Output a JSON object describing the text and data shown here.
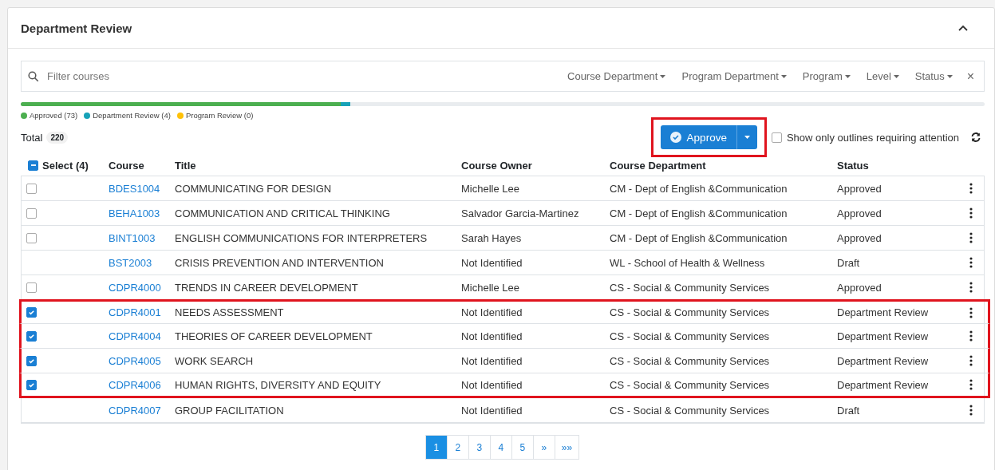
{
  "panel": {
    "title": "Department Review",
    "expanded": true
  },
  "filter": {
    "placeholder": "Filter courses",
    "dropdowns": [
      "Course Department",
      "Program Department",
      "Program",
      "Level",
      "Status"
    ],
    "clear": "×"
  },
  "progress": [
    {
      "label": "Approved (73)",
      "color": "#4caf50",
      "level": 0.332
    },
    {
      "label": "Department Review (4)",
      "color": "#17a2b8"
    },
    {
      "label": "Program Review (0)",
      "color": "#ffc107"
    }
  ],
  "total": {
    "label": "Total",
    "count": "220"
  },
  "approve": {
    "label": "Approve",
    "highlighted": true
  },
  "attention": {
    "label": "Show only outlines requiring attention",
    "checked": false
  },
  "table": {
    "select_all": {
      "checked": true,
      "indeterminate": true
    },
    "columns": [
      "Select (4)",
      "Course",
      "Title",
      "Course Owner",
      "Course Department",
      "Status"
    ],
    "rows": [
      {
        "checked": false,
        "highlighted": false,
        "course": "BDES1004",
        "title": "COMMUNICATING FOR DESIGN",
        "owner": "Michelle Lee",
        "department": "CM - Dept of English &Communication",
        "status": "Approved"
      },
      {
        "checked": false,
        "highlighted": false,
        "course": "BEHA1003",
        "title": "COMMUNICATION AND CRITICAL THINKING",
        "owner": "Salvador Garcia-Martinez",
        "department": "CM - Dept of English &Communication",
        "status": "Approved"
      },
      {
        "checked": false,
        "highlighted": false,
        "course": "BINT1003",
        "title": "ENGLISH COMMUNICATIONS FOR INTERPRETERS",
        "owner": "Sarah Hayes",
        "department": "CM - Dept of English &Communication",
        "status": "Approved"
      },
      {
        "highlighted": false,
        "course": "BST2003",
        "title": "CRISIS PREVENTION AND INTERVENTION",
        "owner": "Not Identified",
        "department": "WL - School of Health & Wellness",
        "status": "Draft"
      },
      {
        "checked": false,
        "highlighted": false,
        "course": "CDPR4000",
        "title": "TRENDS IN CAREER DEVELOPMENT",
        "owner": "Michelle Lee",
        "department": "CS - Social & Community Services",
        "status": "Approved"
      },
      {
        "checked": true,
        "highlighted": true,
        "course": "CDPR4001",
        "title": "NEEDS ASSESSMENT",
        "owner": "Not Identified",
        "department": "CS - Social & Community Services",
        "status": "Department Review"
      },
      {
        "checked": true,
        "highlighted": true,
        "course": "CDPR4004",
        "title": "THEORIES OF CAREER DEVELOPMENT",
        "owner": "Not Identified",
        "department": "CS - Social & Community Services",
        "status": "Department Review"
      },
      {
        "checked": true,
        "highlighted": true,
        "course": "CDPR4005",
        "title": "WORK SEARCH",
        "owner": "Not Identified",
        "department": "CS - Social & Community Services",
        "status": "Department Review"
      },
      {
        "checked": true,
        "highlighted": true,
        "course": "CDPR4006",
        "title": "HUMAN RIGHTS, DIVERSITY AND EQUITY",
        "owner": "Not Identified",
        "department": "CS - Social & Community Services",
        "status": "Department Review"
      },
      {
        "highlighted": false,
        "course": "CDPR4007",
        "title": "GROUP FACILITATION",
        "owner": "Not Identified",
        "department": "CS - Social & Community Services",
        "status": "Draft"
      }
    ]
  },
  "pagination": [
    {
      "label": "1",
      "selected": true
    },
    {
      "label": "2",
      "selected": false
    },
    {
      "label": "3",
      "selected": false
    },
    {
      "label": "4",
      "selected": false
    },
    {
      "label": "5",
      "selected": false
    },
    {
      "label": "»",
      "selected": false
    },
    {
      "label": "»»",
      "selected": false
    }
  ]
}
